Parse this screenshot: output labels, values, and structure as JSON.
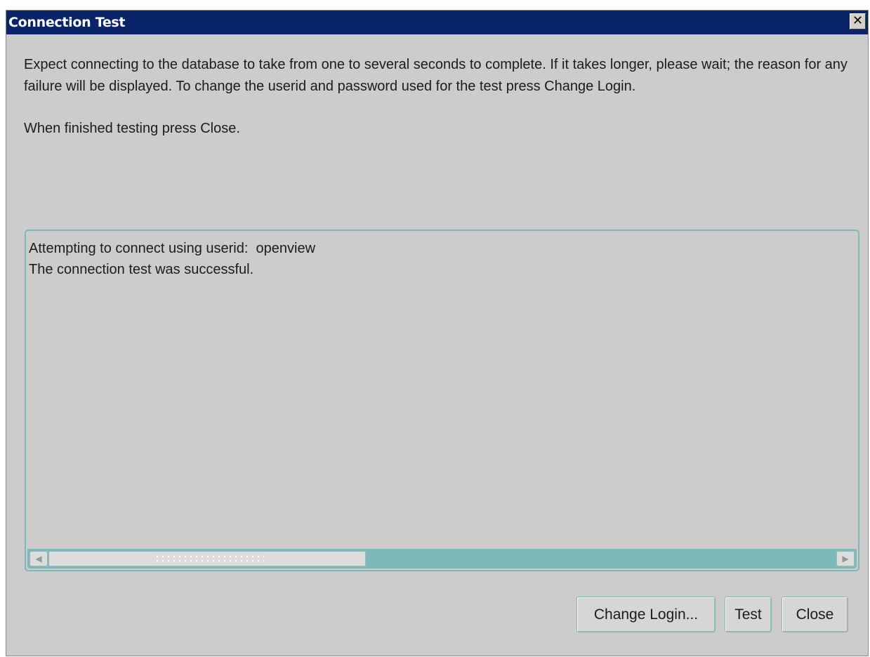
{
  "window": {
    "title": "Connection Test",
    "close_glyph": "✕"
  },
  "instructions": {
    "paragraph1": "Expect connecting to the database to take from one to several seconds to complete. If it takes longer, please wait; the reason for any failure will be displayed. To change the userid and password used for the test press Change Login.",
    "paragraph2": "When finished testing press Close."
  },
  "output": {
    "lines": [
      "Attempting to connect using userid:  openview",
      "The connection test was successful."
    ]
  },
  "scrollbar": {
    "left_arrow": "◀",
    "right_arrow": "▶"
  },
  "buttons": {
    "change_login": "Change Login...",
    "test": "Test",
    "close": "Close"
  },
  "colors": {
    "titlebar": "#0a246a",
    "dialog_bg": "#cccccc",
    "accent": "#7cb9bb"
  }
}
